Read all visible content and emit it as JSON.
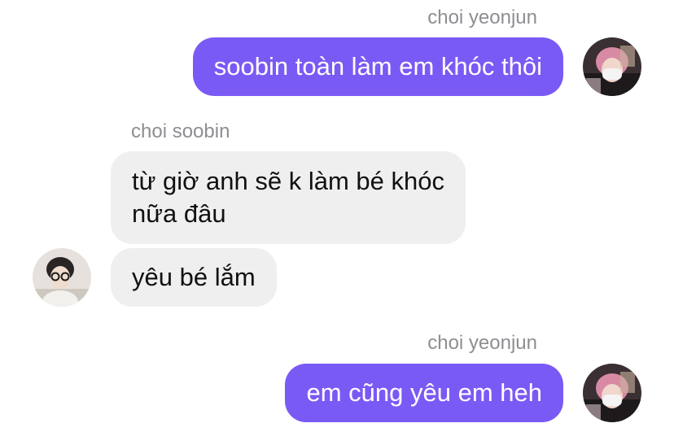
{
  "messages": [
    {
      "sender": "choi yeonjun",
      "text": "soobin toàn làm em khóc thôi",
      "direction": "outgoing"
    },
    {
      "sender": "choi soobin",
      "text_lines": [
        "từ giờ anh sẽ k làm bé khóc",
        "nữa đâu"
      ],
      "direction": "incoming"
    },
    {
      "text": "yêu bé lắm",
      "direction": "incoming"
    },
    {
      "sender": "choi yeonjun",
      "text": "em cũng yêu em heh",
      "direction": "outgoing"
    }
  ],
  "colors": {
    "outgoing_bubble": "#7a5af5",
    "incoming_bubble": "#efeff0",
    "sender_label": "#8e8e93"
  },
  "icons": {
    "yeonjun_avatar": "user-avatar-photo",
    "soobin_avatar": "user-avatar-photo"
  }
}
